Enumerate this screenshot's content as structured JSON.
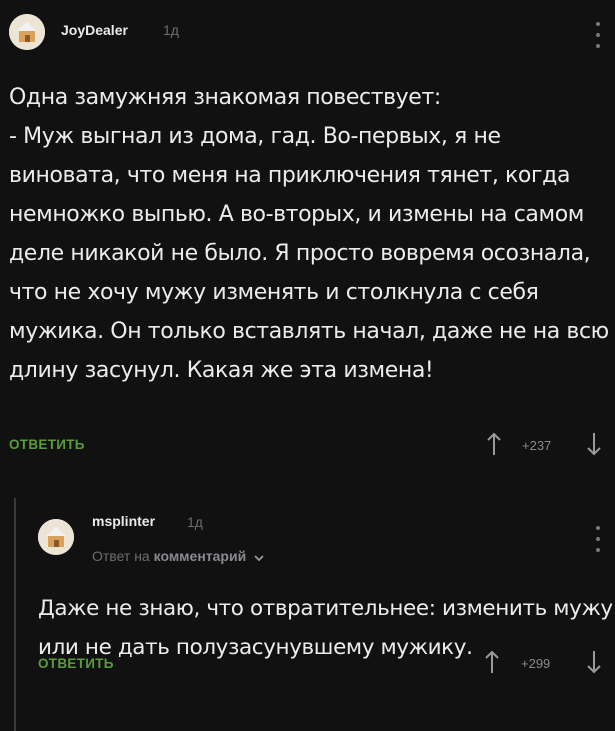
{
  "comments": [
    {
      "author": "JoyDealer",
      "time": "1д",
      "text": "Одна замужняя знакомая повествует:\n- Муж выгнал из дома, гад. Во-первых, я не виновата, что меня на приключения тянет, когда немножко выпью. А во-вторых, и измены на самом деле никакой не было. Я просто вовремя осознала, что не хочу мужу изменять и столкнула с себя мужика. Он только вставлять начал, даже не на всю длину засунул. Какая же эта измена!",
      "reply_label": "ОТВЕТИТЬ",
      "rating": "+237"
    },
    {
      "author": "msplinter",
      "time": "1д",
      "reply_to_prefix": "Ответ на",
      "reply_to_link": "комментарий",
      "text": "Даже не знаю, что отвратительнее: изменить мужу или не дать полузасунувшему мужику.",
      "reply_label": "ОТВЕТИТЬ",
      "rating": "+299"
    }
  ],
  "icons": {
    "avatar": "default-avatar-icon",
    "menu": "kebab-menu-icon",
    "upvote": "arrow-up-icon",
    "downvote": "arrow-down-icon",
    "chevron": "chevron-down-icon"
  },
  "colors": {
    "background": "#111112",
    "text": "#ececec",
    "muted": "#6d6d72",
    "reply_accent": "#5a9c3a"
  }
}
